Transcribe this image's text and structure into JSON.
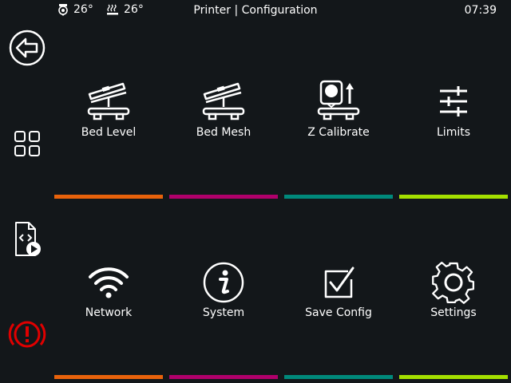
{
  "header": {
    "extruder_temp": "26°",
    "bed_temp": "26°",
    "title": "Printer | Configuration",
    "time": "07:39"
  },
  "sidebar": {
    "items": [
      {
        "name": "back",
        "icon": "back-arrow-icon"
      },
      {
        "name": "menu",
        "icon": "grid-icon"
      },
      {
        "name": "print-files",
        "icon": "gcode-file-play-icon"
      },
      {
        "name": "emergency-stop",
        "icon": "emergency-stop-icon"
      }
    ]
  },
  "tiles": [
    {
      "label": "Bed Level",
      "icon": "bed-level-icon",
      "color": "#e8620b"
    },
    {
      "label": "Bed Mesh",
      "icon": "bed-mesh-icon",
      "color": "#b0006b"
    },
    {
      "label": "Z Calibrate",
      "icon": "z-calibrate-icon",
      "color": "#00897b"
    },
    {
      "label": "Limits",
      "icon": "limits-sliders-icon",
      "color": "#a4e000"
    },
    {
      "label": "Network",
      "icon": "wifi-icon",
      "color": "#e8620b"
    },
    {
      "label": "System",
      "icon": "info-icon",
      "color": "#b0006b"
    },
    {
      "label": "Save Config",
      "icon": "save-checkbox-icon",
      "color": "#00897b"
    },
    {
      "label": "Settings",
      "icon": "settings-gear-icon",
      "color": "#a4e000"
    }
  ],
  "colors": {
    "background": "#13171a",
    "emergency": "#e00000"
  }
}
